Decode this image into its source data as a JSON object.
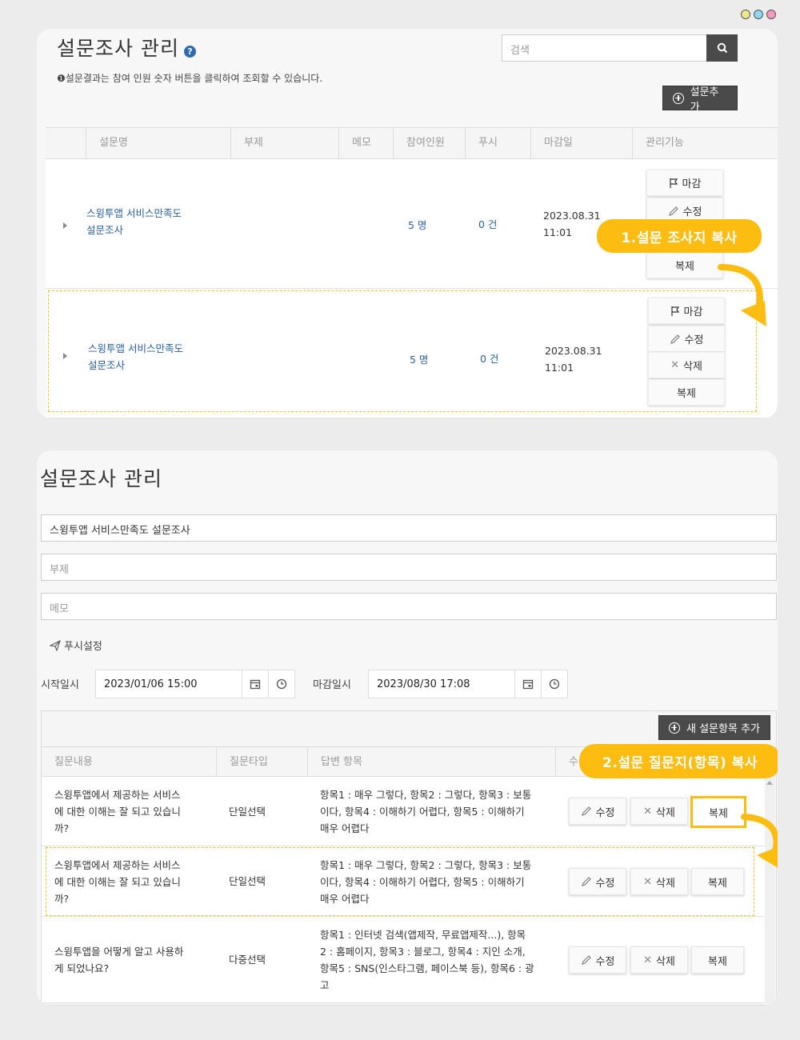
{
  "window_dots": [
    "#ede88a",
    "#8fd7f0",
    "#f49ac1"
  ],
  "panel1": {
    "title": "설문조사 관리",
    "help_icon": "?",
    "search_placeholder": "검색",
    "info_text": "❶설문결과는 참여 인원 숫자 버튼을 클릭하여 조회할 수 있습니다.",
    "add_button": "설문추가",
    "columns": [
      "설문명",
      "부제",
      "메모",
      "참여인원",
      "푸시",
      "마감일",
      "관리기능"
    ],
    "rows": [
      {
        "name_line1": "스윙투앱 서비스만족도",
        "name_line2": "설문조사",
        "participants": "5 명",
        "push": "0 건",
        "deadline_date": "2023.08.31",
        "deadline_time": "11:01"
      },
      {
        "name_line1": "스윙투앱 서비스만족도",
        "name_line2": "설문조사",
        "participants": "5 명",
        "push": "0 건",
        "deadline_date": "2023.08.31",
        "deadline_time": "11:01"
      }
    ],
    "actions": {
      "close": "마감",
      "edit": "수정",
      "delete": "삭제",
      "copy": "복제"
    },
    "callout": "1.설문 조사지 복사"
  },
  "panel2": {
    "title": "설문조사 관리",
    "title_value": "스윙투앱 서비스만족도 설문조사",
    "subtitle_placeholder": "부제",
    "memo_placeholder": "메모",
    "push_setting": "푸시설정",
    "start_label": "시작일시",
    "start_value": "2023/01/06 15:00",
    "end_label": "마감일시",
    "end_value": "2023/08/30 17:08",
    "add_item_button": "새 설문항목 추가",
    "columns": [
      "질문내용",
      "질문타입",
      "답변 항목",
      "수"
    ],
    "rows": [
      {
        "q1": "스윙투앱에서 제공하는 서비스",
        "q2": "에 대한 이해는 잘 되고 있습니",
        "q3": "까?",
        "type": "단일선택",
        "a1": "항목1 : 매우 그렇다, 항목2 : 그렇다, 항목3 : 보통",
        "a2": "이다, 항목4 : 이해하기 어렵다, 항목5 : 이해하기",
        "a3": "매우 어렵다",
        "a4": ""
      },
      {
        "q1": "스윙투앱에서 제공하는 서비스",
        "q2": "에 대한 이해는 잘 되고 있습니",
        "q3": "까?",
        "type": "단일선택",
        "a1": "항목1 : 매우 그렇다, 항목2 : 그렇다, 항목3 : 보통",
        "a2": "이다, 항목4 : 이해하기 어렵다, 항목5 : 이해하기",
        "a3": "매우 어렵다",
        "a4": ""
      },
      {
        "q1": "스윙투앱을 어떻게 알고 사용하",
        "q2": "게 되었나요?",
        "q3": "",
        "type": "다중선택",
        "a1": "항목1 : 인터넷 검색(앱제작, 무료앱제작...), 항목",
        "a2": "2 : 홈페이지, 항목3 : 블로그, 항목4 : 지인 소개,",
        "a3": "항목5 : SNS(인스타그램, 페이스북 등), 항목6 : 광",
        "a4": "고"
      }
    ],
    "actions": {
      "edit": "수정",
      "delete": "삭제",
      "copy": "복제"
    },
    "callout": "2.설문 질문지(항목) 복사"
  },
  "colors": {
    "accent_yellow": "#fcbc10",
    "dark_button": "#4a4a4a",
    "link_blue": "#2a5f9e"
  }
}
